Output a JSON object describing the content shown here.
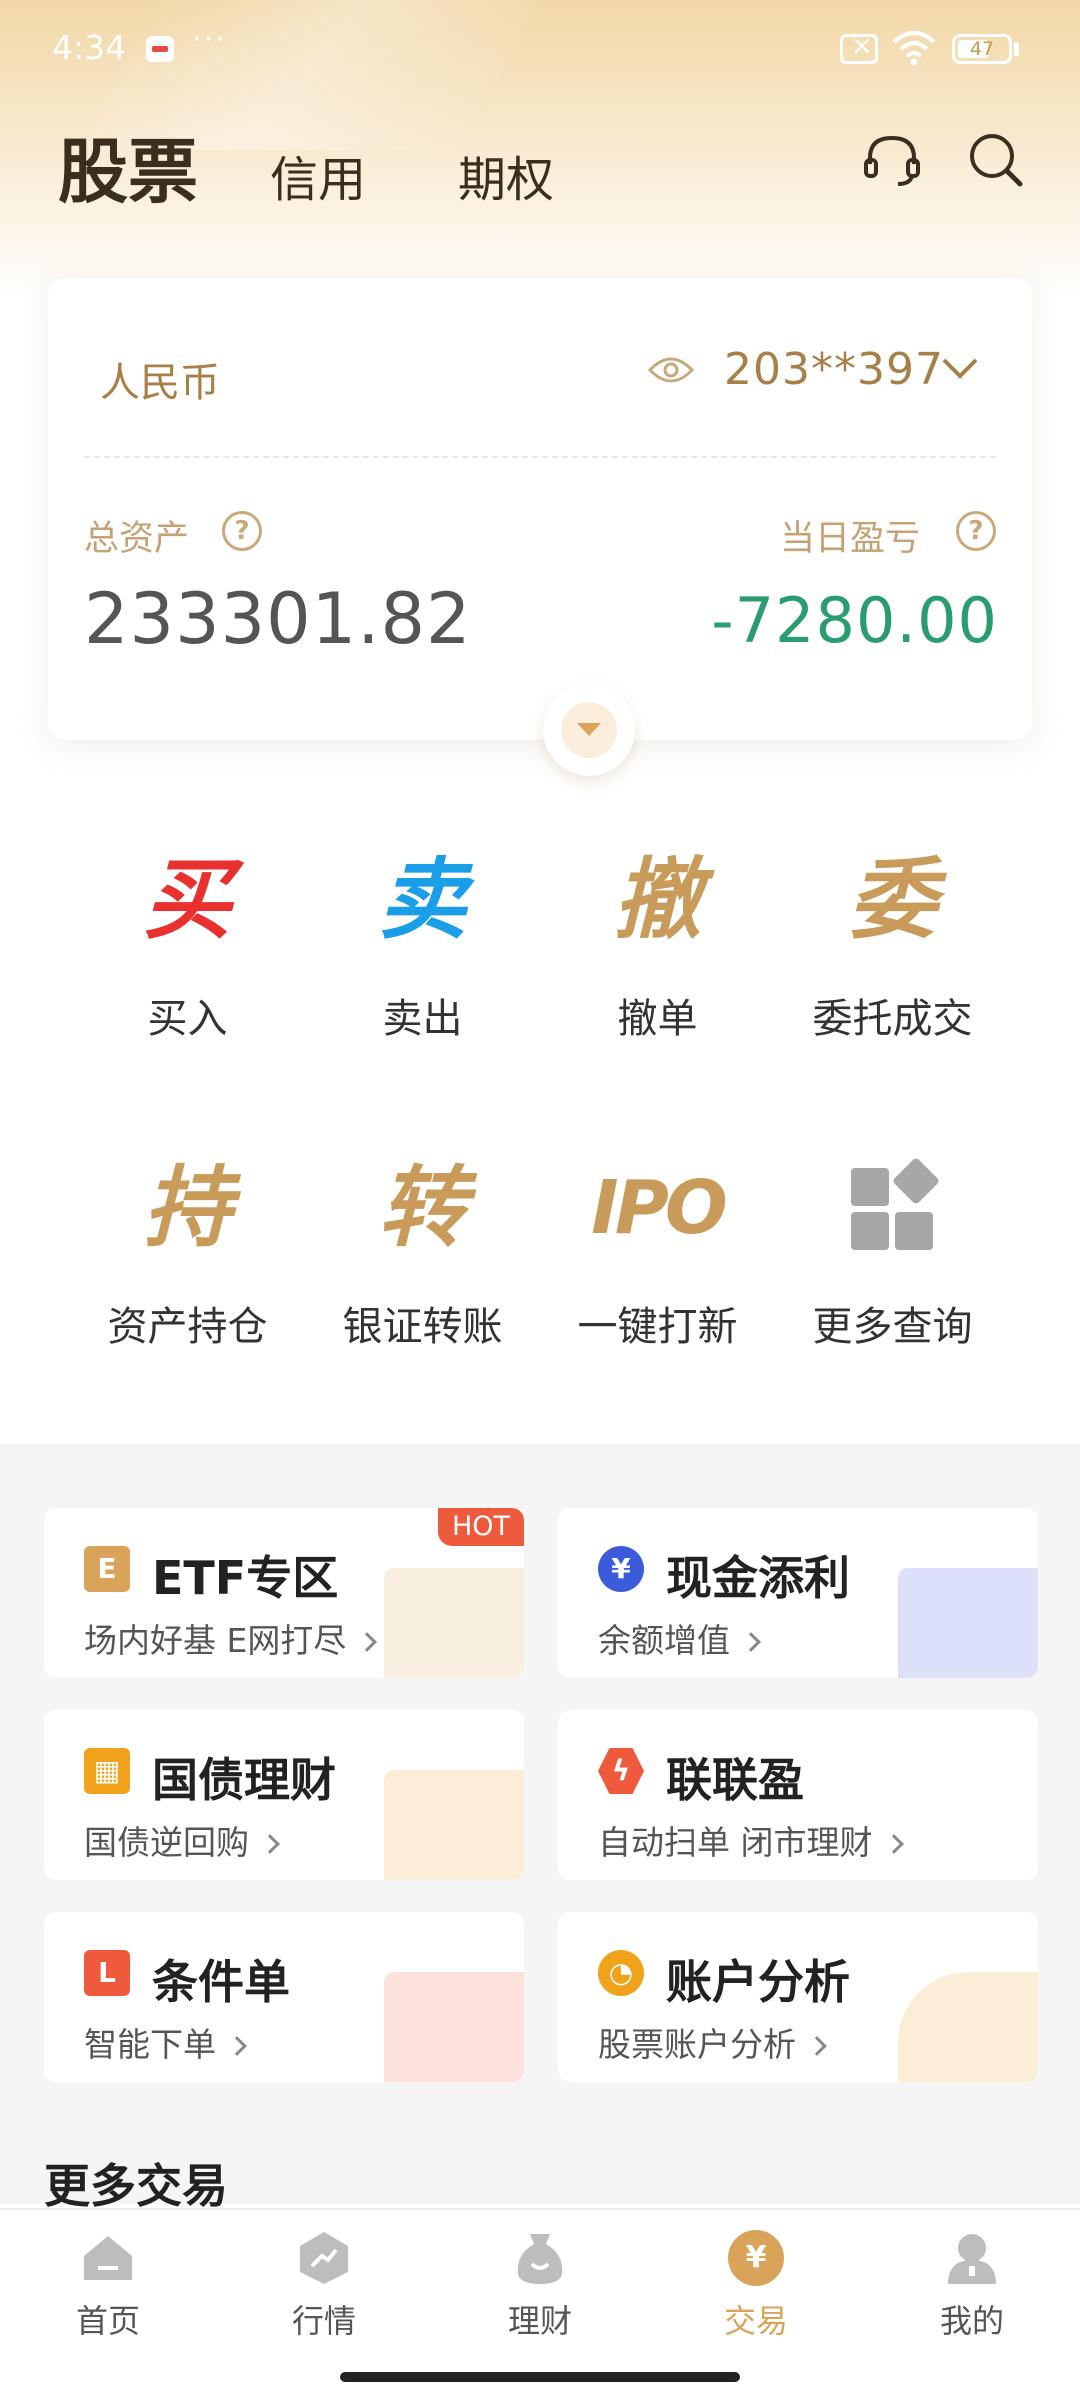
{
  "status_bar": {
    "time": "4:34",
    "dots": "···",
    "battery": "47"
  },
  "header": {
    "tabs": [
      {
        "label": "股票"
      },
      {
        "label": "信用"
      },
      {
        "label": "期权"
      }
    ]
  },
  "account": {
    "currency": "人民币",
    "account_no": "203**397",
    "total_assets_label": "总资产",
    "total_assets": "233301.82",
    "daily_pnl_label": "当日盈亏",
    "daily_pnl": "-7280.00",
    "help_glyph": "?"
  },
  "actions": [
    {
      "glyph": "买",
      "label": "买入",
      "color": "#e8302f"
    },
    {
      "glyph": "卖",
      "label": "卖出",
      "color": "#1a9ee8"
    },
    {
      "glyph": "撤",
      "label": "撤单",
      "color": "#c99b5a"
    },
    {
      "glyph": "委",
      "label": "委托成交",
      "color": "#c99b5a"
    },
    {
      "glyph": "持",
      "label": "资产持仓",
      "color": "#c99b5a"
    },
    {
      "glyph": "转",
      "label": "银证转账",
      "color": "#c99b5a"
    },
    {
      "glyph": "IPO",
      "label": "一键打新",
      "color": "#c99b5a"
    },
    {
      "glyph": "",
      "label": "更多查询",
      "color": "#a6a6a6"
    }
  ],
  "features": [
    {
      "title": "ETF专区",
      "subtitle": "场内好基 E网打尽",
      "icon_glyph": "E",
      "badge": "HOT",
      "color": "#d9a45a"
    },
    {
      "title": "现金添利",
      "subtitle": "余额增值",
      "icon_glyph": "¥",
      "color": "#3b5bdb"
    },
    {
      "title": "国债理财",
      "subtitle": "国债逆回购",
      "icon_glyph": "▦",
      "color": "#f0a21a"
    },
    {
      "title": "联联盈",
      "subtitle": "自动扫单 闭市理财",
      "icon_glyph": "ϟ",
      "color": "#ef5a3c"
    },
    {
      "title": "条件单",
      "subtitle": "智能下单",
      "icon_glyph": "L",
      "color": "#ef5a3c"
    },
    {
      "title": "账户分析",
      "subtitle": "股票账户分析",
      "icon_glyph": "◔",
      "color": "#f0a21a"
    }
  ],
  "more_trade_title": "更多交易",
  "bottom_nav": [
    {
      "label": "首页"
    },
    {
      "label": "行情"
    },
    {
      "label": "理财"
    },
    {
      "label": "交易",
      "active": true,
      "icon_glyph": "¥"
    },
    {
      "label": "我的"
    }
  ],
  "colors": {
    "accent": "#d9a45a",
    "profit_green": "#2a9d6f",
    "gold_text": "#a87f47"
  }
}
